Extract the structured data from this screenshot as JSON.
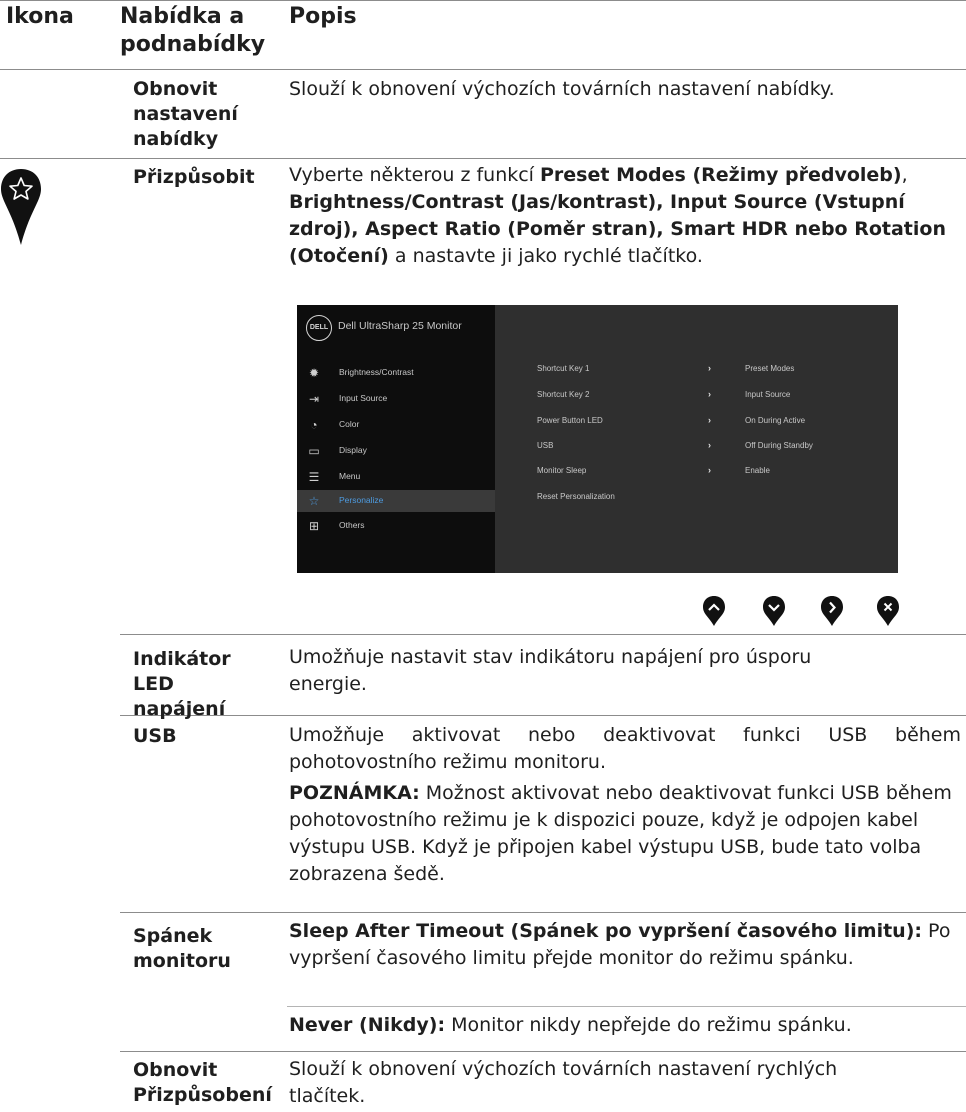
{
  "header": {
    "col1": "Ikona",
    "col2": "Nabídka a podnabídky",
    "col3": "Popis"
  },
  "rows": {
    "reset_menu": {
      "label": "Obnovit nastavení nabídky",
      "desc": "Slouží k obnovení výchozích továrních nastavení nabídky."
    },
    "personalize": {
      "icon": "star-icon",
      "label": "Přizpůsobit",
      "desc_prefix": "Vyberte některou z funkcí ",
      "desc_bold1": "Preset Modes (Režimy předvoleb)",
      "desc_comma": ", ",
      "desc_bold2": "Brightness/Contrast (Jas/kontrast), Input Source (Vstupní zdroj), Aspect Ratio (Poměr stran), Smart HDR nebo Rotation (Otočení)",
      "desc_suffix": " a nastavte ji jako rychlé tlačítko."
    },
    "power_led": {
      "label": "Indikátor LED napájení",
      "desc": "Umožňuje nastavit stav indikátoru napájení pro úsporu energie."
    },
    "usb": {
      "label": "USB",
      "desc": "Umožňuje aktivovat nebo deaktivovat funkci USB během pohotovostního režimu monitoru.",
      "note_label": "POZNÁMKA:",
      "note_text": " Možnost aktivovat nebo deaktivovat funkci USB během pohotovostního režimu je k dispozici pouze, když je odpojen kabel výstupu USB. Když je připojen kabel výstupu USB, bude tato volba zobrazena šedě."
    },
    "monitor_sleep": {
      "label": "Spánek monitoru",
      "opt1_label": "Sleep After Timeout (Spánek po vypršení časového limitu):",
      "opt1_text": " Po vypršení časového limitu přejde monitor do režimu spánku.",
      "opt2_label": "Never (Nikdy):",
      "opt2_text": " Monitor nikdy nepřejde do režimu spánku."
    },
    "reset_personalization": {
      "label": "Obnovit Přizpůsobení",
      "desc": "Slouží k obnovení výchozích továrních nastavení rychlých tlačítek."
    }
  },
  "osd": {
    "logo": "DELL",
    "title": "Dell UltraSharp 25 Monitor",
    "menu": [
      {
        "label": "Brightness/Contrast",
        "icon": "sun-icon"
      },
      {
        "label": "Input Source",
        "icon": "input-icon"
      },
      {
        "label": "Color",
        "icon": "palette-icon"
      },
      {
        "label": "Display",
        "icon": "monitor-icon"
      },
      {
        "label": "Menu",
        "icon": "menu-icon"
      },
      {
        "label": "Personalize",
        "icon": "star-icon",
        "active": true
      },
      {
        "label": "Others",
        "icon": "others-icon"
      }
    ],
    "settings": [
      {
        "key": "Shortcut Key 1",
        "value": "Preset Modes"
      },
      {
        "key": "Shortcut Key 2",
        "value": "Input Source"
      },
      {
        "key": "Power Button LED",
        "value": "On During Active"
      },
      {
        "key": "USB",
        "value": "Off During Standby"
      },
      {
        "key": "Monitor Sleep",
        "value": "Enable"
      },
      {
        "key": "Reset Personalization",
        "value": ""
      }
    ],
    "active_color": "#4d9be0"
  },
  "hotkeys": [
    "up-arrow-icon",
    "down-arrow-icon",
    "right-arrow-icon",
    "close-icon"
  ]
}
